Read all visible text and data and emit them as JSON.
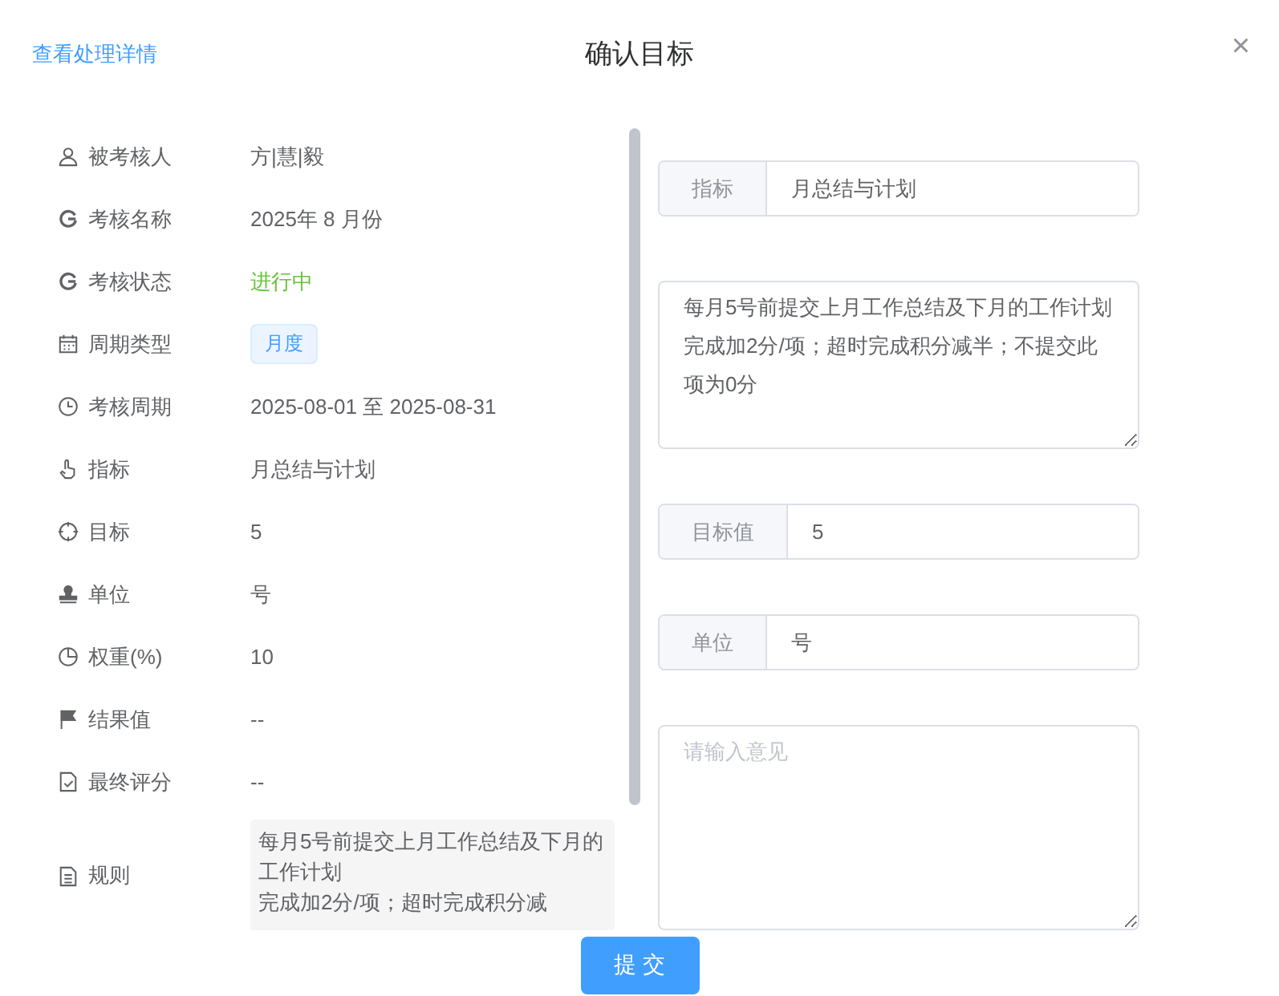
{
  "header": {
    "link": "查看处理详情",
    "title": "确认目标",
    "close": "×"
  },
  "details": [
    {
      "label": "被考核人",
      "kind": "text",
      "value": "方|慧|毅"
    },
    {
      "label": "考核名称",
      "kind": "text",
      "value": "2025年 8 月份"
    },
    {
      "label": "考核状态",
      "kind": "status",
      "value": "进行中"
    },
    {
      "label": "周期类型",
      "kind": "tag",
      "value": "月度"
    },
    {
      "label": "考核周期",
      "kind": "text",
      "value": "2025-08-01 至 2025-08-31"
    },
    {
      "label": "指标",
      "kind": "text",
      "value": "月总结与计划"
    },
    {
      "label": "目标",
      "kind": "text",
      "value": "5"
    },
    {
      "label": "单位",
      "kind": "text",
      "value": "号"
    },
    {
      "label": "权重(%)",
      "kind": "text",
      "value": "10"
    },
    {
      "label": "结果值",
      "kind": "text",
      "value": "--"
    },
    {
      "label": "最终评分",
      "kind": "text",
      "value": "--"
    },
    {
      "label": "规则",
      "kind": "rule",
      "lines": [
        "每月5号前提交上月工作总结及下月的工作计划",
        "完成加2分/项；超时完成积分减"
      ]
    }
  ],
  "form": [
    {
      "kind": "input",
      "label": "指标",
      "value": "月总结与计划"
    },
    {
      "kind": "textarea",
      "lines": [
        "每月5号前提交上月工作总结及下月的工作计划",
        "完成加2分/项；超时完成积分减半；不提交此项为0分"
      ]
    },
    {
      "kind": "input",
      "label": "目标值",
      "value": "5"
    },
    {
      "kind": "input",
      "label": "单位",
      "value": "号"
    },
    {
      "kind": "comment",
      "placeholder": "请输入意见"
    }
  ],
  "submit": "提 交"
}
